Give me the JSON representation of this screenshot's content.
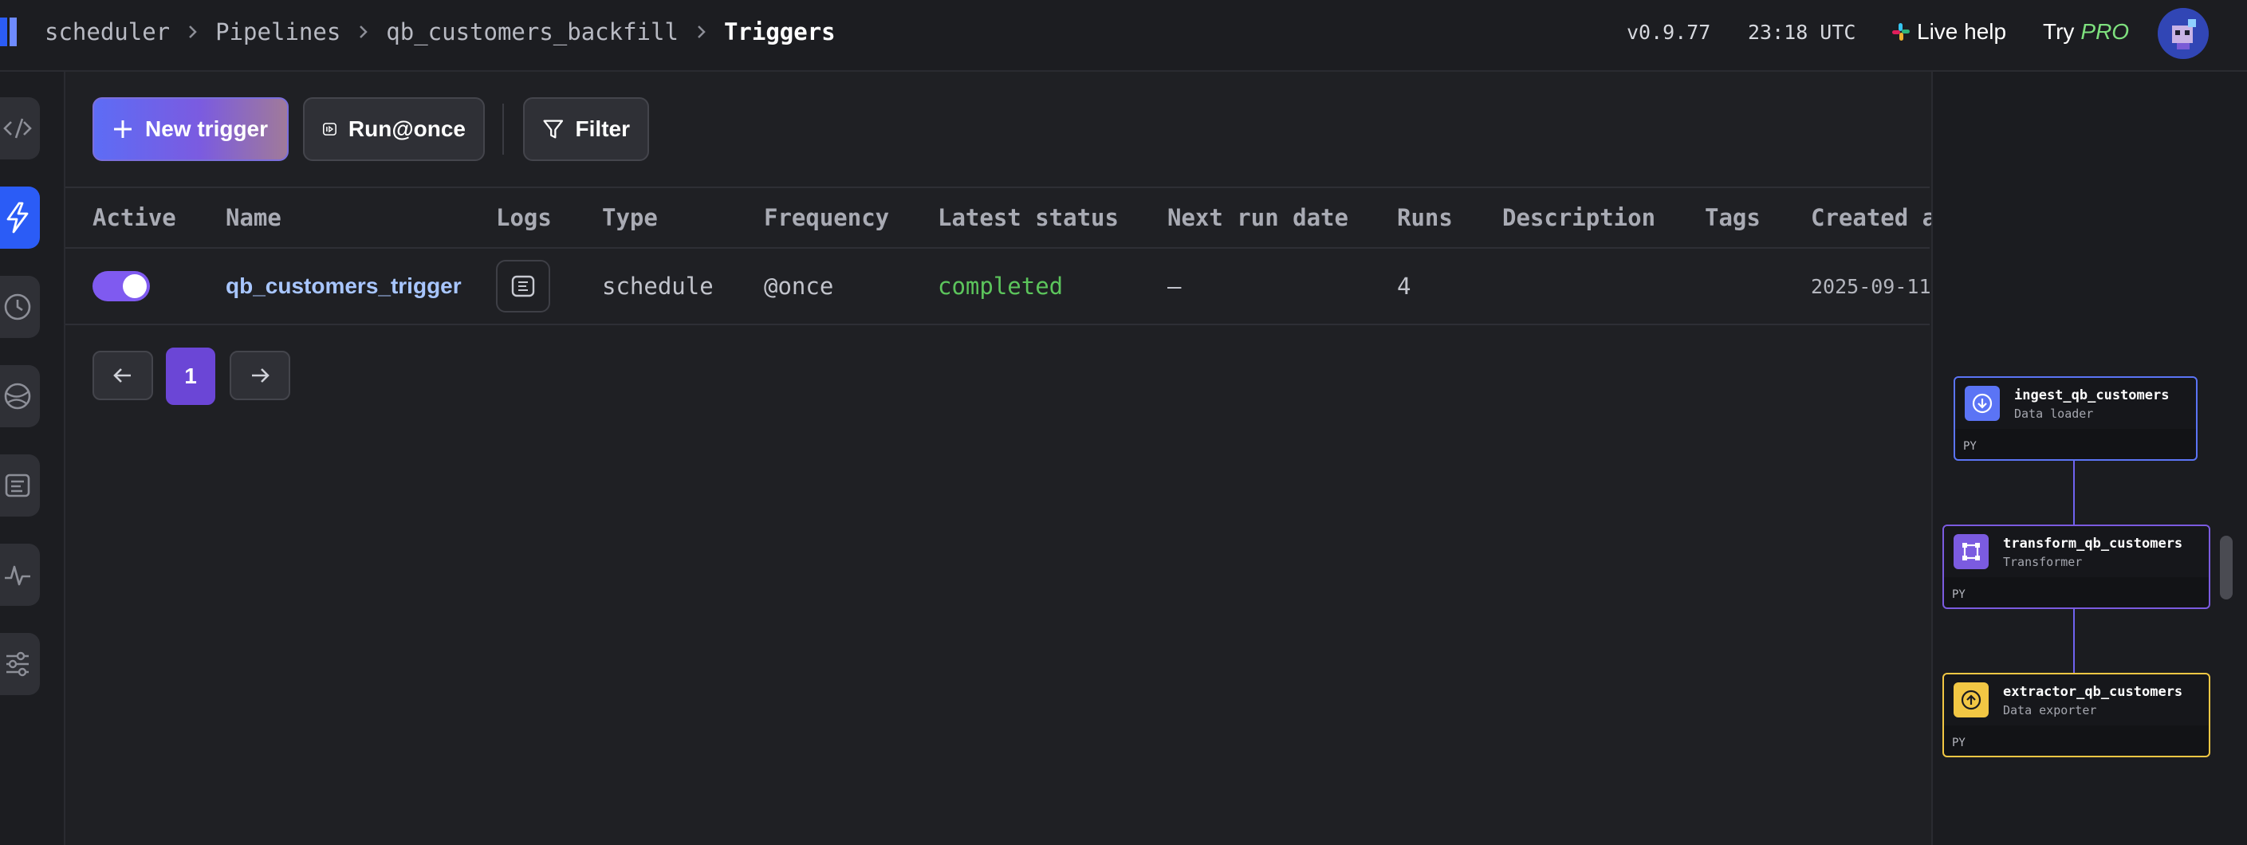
{
  "header": {
    "breadcrumbs": [
      "scheduler",
      "Pipelines",
      "qb_customers_backfill"
    ],
    "current": "Triggers",
    "version": "v0.9.77",
    "time": "23:18 UTC",
    "live_help": "Live help",
    "try_label": "Try",
    "pro_label": "PRO"
  },
  "sidebar": {
    "items": [
      {
        "icon": "code-icon",
        "active": false
      },
      {
        "icon": "lightning-icon",
        "active": true
      },
      {
        "icon": "clock-icon",
        "active": false
      },
      {
        "icon": "globe-icon",
        "active": false
      },
      {
        "icon": "logs-icon",
        "active": false
      },
      {
        "icon": "monitor-icon",
        "active": false
      },
      {
        "icon": "settings-sliders-icon",
        "active": false
      }
    ]
  },
  "toolbar": {
    "new_trigger": "New trigger",
    "run_once": "Run@once",
    "filter": "Filter"
  },
  "table": {
    "columns": [
      "Active",
      "Name",
      "Logs",
      "Type",
      "Frequency",
      "Latest status",
      "Next run date",
      "Runs",
      "Description",
      "Tags",
      "Created a"
    ],
    "rows": [
      {
        "active": true,
        "name": "qb_customers_trigger",
        "type": "schedule",
        "frequency": "@once",
        "latest_status": "completed",
        "next_run_date": "–",
        "runs": "4",
        "description": "",
        "tags": "",
        "created_at": "2025-09-11"
      }
    ]
  },
  "pagination": {
    "current_page": "1"
  },
  "dependency_graph": {
    "blocks": [
      {
        "name": "ingest_qb_customers",
        "type": "Data loader",
        "lang": "PY",
        "color": "#5b74f5"
      },
      {
        "name": "transform_qb_customers",
        "type": "Transformer",
        "lang": "PY",
        "color": "#7b5be0"
      },
      {
        "name": "extractor_qb_customers",
        "type": "Data exporter",
        "lang": "PY",
        "color": "#f2c744"
      }
    ]
  },
  "colors": {
    "accent": "#7f5af0",
    "active_nav": "#2b5cf6",
    "status_completed": "#5cc55c",
    "link": "#a8c6ff"
  }
}
